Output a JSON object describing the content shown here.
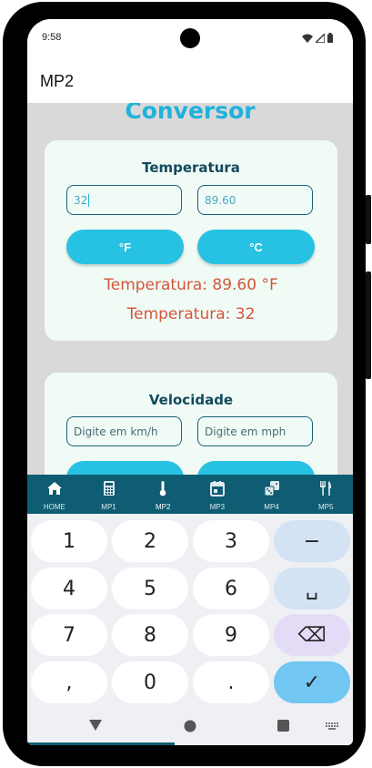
{
  "status_bar": {
    "time": "9:58"
  },
  "app_bar": {
    "title": "MP2"
  },
  "page": {
    "title": "Conversor"
  },
  "temperature_card": {
    "title": "Temperatura",
    "input_left_value": "32",
    "input_right_value": "89.60",
    "button_left": "°F",
    "button_right": "°C",
    "result_1": "Temperatura: 89.60 °F",
    "result_2": "Temperatura: 32"
  },
  "speed_card": {
    "title": "Velocidade",
    "input_left_placeholder": "Digite em km/h",
    "input_right_placeholder": "Digite em mph"
  },
  "bottom_nav": {
    "items": [
      {
        "label": "HOME",
        "icon": "home-icon"
      },
      {
        "label": "MP1",
        "icon": "calculator-icon"
      },
      {
        "label": "MP2",
        "icon": "thermometer-icon",
        "active": true
      },
      {
        "label": "MP3",
        "icon": "calendar-icon"
      },
      {
        "label": "MP4",
        "icon": "dice-icon"
      },
      {
        "label": "MP5",
        "icon": "restaurant-icon"
      }
    ]
  },
  "keyboard": {
    "rows": [
      [
        "1",
        "2",
        "3",
        "−"
      ],
      [
        "4",
        "5",
        "6",
        "␣"
      ],
      [
        "7",
        "8",
        "9",
        "⌫"
      ],
      [
        ",",
        "0",
        ".",
        "✓"
      ]
    ]
  },
  "colors": {
    "accent": "#27c2e3",
    "title": "#1fb2db",
    "nav_bg": "#0e5d73",
    "result_text": "#d5553b",
    "card_bg": "#f0fbf6"
  }
}
